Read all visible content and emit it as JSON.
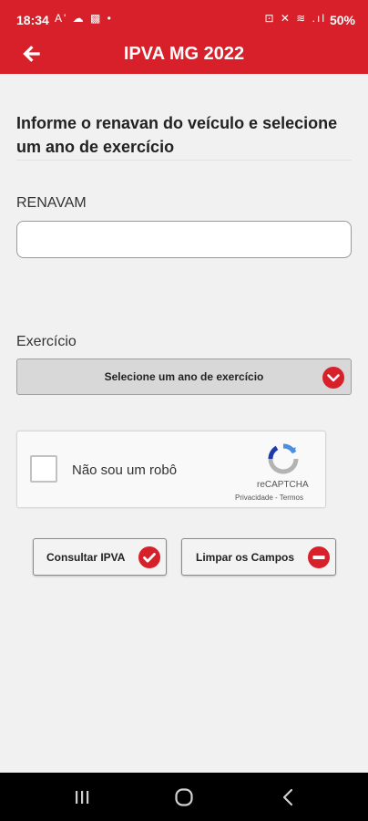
{
  "status_bar": {
    "time": "18:34",
    "left_icons": "A' ☁ ▩ •",
    "right_icons": "⊡ ✕ ≋ .ıl",
    "battery": "50%"
  },
  "app_bar": {
    "title": "IPVA MG 2022",
    "back_icon": "arrow-left-icon"
  },
  "form": {
    "heading": "Informe o renavan do veículo e selecione um ano de exercício",
    "renavam_label": "RENAVAM",
    "renavam_value": "",
    "exercicio_label": "Exercício",
    "exercicio_placeholder": "Selecione um ano de exercício"
  },
  "captcha": {
    "label": "Não sou um robô",
    "brand": "reCAPTCHA",
    "links": "Privacidade - Termos"
  },
  "buttons": {
    "consultar": "Consultar IPVA",
    "limpar": "Limpar os Campos"
  },
  "colors": {
    "brand_red": "#d8202a",
    "background": "#f1f1f1"
  }
}
